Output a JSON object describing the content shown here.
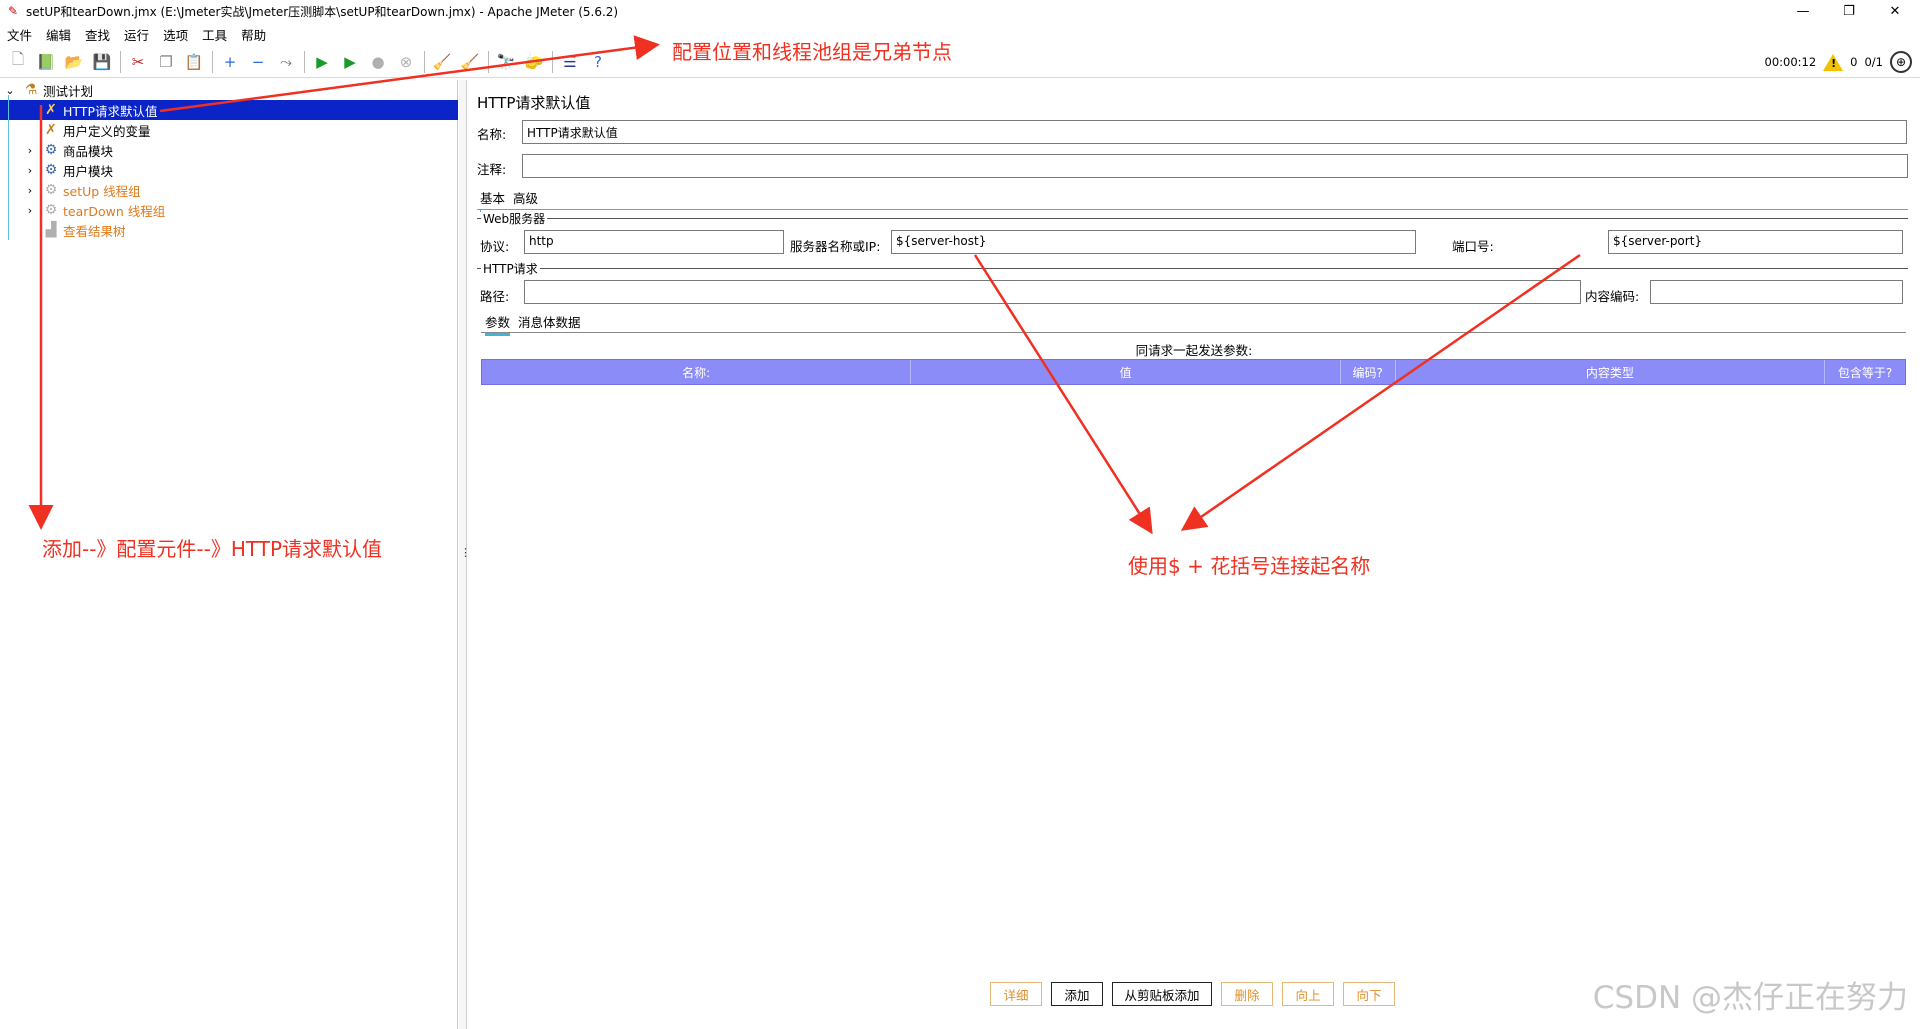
{
  "window": {
    "title": "setUP和tearDown.jmx (E:\\Jmeter实战\\Jmeter压测脚本\\setUP和tearDown.jmx) - Apache JMeter (5.6.2)",
    "controls": {
      "minimize": "—",
      "maximize": "❐",
      "close": "✕"
    }
  },
  "menu": [
    "文件",
    "编辑",
    "查找",
    "运行",
    "选项",
    "工具",
    "帮助"
  ],
  "toolbar": {
    "icons": [
      "new-icon",
      "templates-icon",
      "open-icon",
      "save-icon",
      "cut-icon",
      "copy-icon",
      "paste-icon",
      "expand-icon",
      "collapse-icon",
      "toggle-icon",
      "start-icon",
      "start-no-pause-icon",
      "stop-icon",
      "shutdown-icon",
      "clear-icon",
      "clear-all-icon",
      "search-icon",
      "reset-search-icon",
      "function-helper-icon",
      "help-icon"
    ],
    "glyphs": [
      "🗋",
      "📗",
      "📂",
      "💾",
      "✂",
      "❐",
      "📋",
      "+",
      "−",
      "⤳",
      "▶",
      "▶",
      "●",
      "⊗",
      "🧹",
      "🧹",
      "🔭",
      "🧽",
      "☰",
      "?"
    ],
    "colors": [
      "#888",
      "#2a8a3a",
      "#d8a000",
      "#2a3a88",
      "#c02020",
      "#888",
      "#c08a20",
      "#2a6ad8",
      "#2a6ad8",
      "#666",
      "#1a9a2a",
      "#1a9a2a",
      "#b0b0b0",
      "#b0b0b0",
      "#a07030",
      "#a07030",
      "#333",
      "#c08a20",
      "#2a3a88",
      "#2a6ad8"
    ]
  },
  "status": {
    "timer": "00:00:12",
    "warnings": "0",
    "threads": "0/1"
  },
  "tree": {
    "items": [
      {
        "label": "测试计划",
        "icon": "test-plan-icon",
        "glyph": "⚗",
        "toggle": "⌄",
        "depth": 0,
        "selected": false,
        "orange": false
      },
      {
        "label": "HTTP请求默认值",
        "icon": "config-element-icon",
        "glyph": "✗",
        "toggle": "",
        "depth": 1,
        "selected": true,
        "orange": false
      },
      {
        "label": "用户定义的变量",
        "icon": "config-element-icon",
        "glyph": "✗",
        "toggle": "",
        "depth": 1,
        "selected": false,
        "orange": false
      },
      {
        "label": "商品模块",
        "icon": "thread-group-icon",
        "glyph": "⚙",
        "toggle": "›",
        "depth": 1,
        "selected": false,
        "orange": false
      },
      {
        "label": "用户模块",
        "icon": "thread-group-icon",
        "glyph": "⚙",
        "toggle": "›",
        "depth": 1,
        "selected": false,
        "orange": false
      },
      {
        "label": "setUp 线程组",
        "icon": "setup-thread-group-icon",
        "glyph": "⚙",
        "toggle": "›",
        "depth": 1,
        "selected": false,
        "orange": true
      },
      {
        "label": "tearDown 线程组",
        "icon": "teardown-thread-group-icon",
        "glyph": "⚙",
        "toggle": "›",
        "depth": 1,
        "selected": false,
        "orange": true
      },
      {
        "label": "查看结果树",
        "icon": "listener-icon",
        "glyph": "▟",
        "toggle": "",
        "depth": 1,
        "selected": false,
        "orange": true
      }
    ]
  },
  "panel": {
    "title": "HTTP请求默认值",
    "name_label": "名称:",
    "name_value": "HTTP请求默认值",
    "comment_label": "注释:",
    "comment_value": "",
    "tabs": [
      "基本",
      "高级"
    ],
    "web_server": {
      "group_title": "Web服务器",
      "protocol_label": "协议:",
      "protocol_value": "http",
      "server_label": "服务器名称或IP:",
      "server_value": "${server-host}",
      "port_label": "端口号:",
      "port_value": "${server-port}"
    },
    "http_request": {
      "group_title": "HTTP请求",
      "path_label": "路径:",
      "path_value": "",
      "encoding_label": "内容编码:",
      "encoding_value": ""
    },
    "subtabs": [
      "参数",
      "消息体数据"
    ],
    "params_caption": "同请求一起发送参数:",
    "table_columns": [
      "名称:",
      "值",
      "编码?",
      "内容类型",
      "包含等于?"
    ],
    "buttons": {
      "detail": "详细",
      "add": "添加",
      "add_clipboard": "从剪贴板添加",
      "delete": "删除",
      "up": "向上",
      "down": "向下"
    }
  },
  "annotations": {
    "top_note": "配置位置和线程池组是兄弟节点",
    "left_note": "添加--》配置元件--》HTTP请求默认值",
    "center_note": "使用$ + 花括号连接起名称",
    "color": "#f03020"
  },
  "watermark": "CSDN @杰仔正在努力"
}
